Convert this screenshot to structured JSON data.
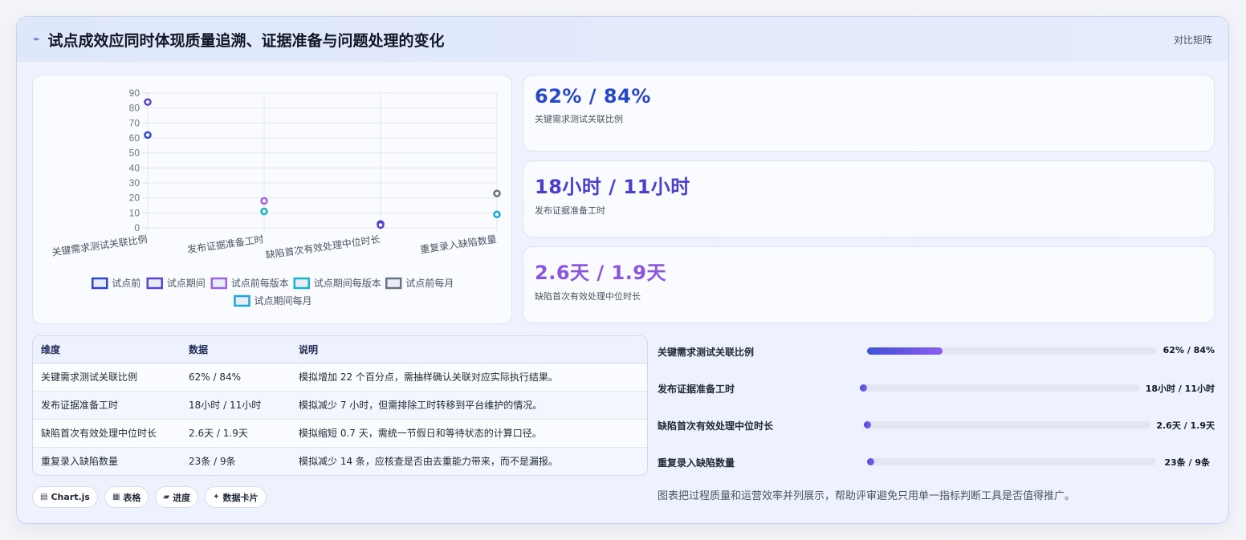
{
  "header": {
    "title": "试点成效应同时体现质量追溯、证据准备与问题处理的变化",
    "tag": "对比矩阵"
  },
  "chart_data": {
    "type": "scatter",
    "categories": [
      "关键需求测试关联比例",
      "发布证据准备工时",
      "缺陷首次有效处理中位时长",
      "重复录入缺陷数量"
    ],
    "yticks": [
      0,
      10,
      20,
      30,
      40,
      50,
      60,
      70,
      80,
      90
    ],
    "ylim": [
      0,
      90
    ],
    "grid": true,
    "legend_position": "bottom",
    "series": [
      {
        "name": "试点前",
        "color": "#2e45c7",
        "points": [
          {
            "category": 0,
            "y": 62
          },
          {
            "category": 2,
            "y": 2.6
          }
        ]
      },
      {
        "name": "试点期间",
        "color": "#5a43d0",
        "points": [
          {
            "category": 0,
            "y": 84
          },
          {
            "category": 2,
            "y": 1.9
          }
        ]
      },
      {
        "name": "试点前每版本",
        "color": "#9a63e0",
        "points": [
          {
            "category": 1,
            "y": 18
          }
        ]
      },
      {
        "name": "试点期间每版本",
        "color": "#19b3c9",
        "points": [
          {
            "category": 1,
            "y": 11
          }
        ]
      },
      {
        "name": "试点前每月",
        "color": "#6b7280",
        "points": [
          {
            "category": 3,
            "y": 23
          }
        ]
      },
      {
        "name": "试点期间每月",
        "color": "#1ea6d6",
        "points": [
          {
            "category": 3,
            "y": 9
          }
        ]
      }
    ]
  },
  "stats": [
    {
      "value": "62% / 84%",
      "label": "关键需求测试关联比例",
      "color": "#2a47c8"
    },
    {
      "value": "18小时 / 11小时",
      "label": "发布证据准备工时",
      "color": "#4b3fcf"
    },
    {
      "value": "2.6天 / 1.9天",
      "label": "缺陷首次有效处理中位时长",
      "color": "#8b55e0"
    }
  ],
  "table": {
    "headers": [
      "维度",
      "数据",
      "说明"
    ],
    "rows": [
      [
        "关键需求测试关联比例",
        "62% / 84%",
        "模拟增加 22 个百分点，需抽样确认关联对应实际执行结果。"
      ],
      [
        "发布证据准备工时",
        "18小时 / 11小时",
        "模拟减少 7 小时，但需排除工时转移到平台维护的情况。"
      ],
      [
        "缺陷首次有效处理中位时长",
        "2.6天 / 1.9天",
        "模拟缩短 0.7 天，需统一节假日和等待状态的计算口径。"
      ],
      [
        "重复录入缺陷数量",
        "23条 / 9条",
        "模拟减少 14 条，应核查是否由去重能力带来，而不是漏报。"
      ]
    ]
  },
  "chips": [
    {
      "icon": "▤",
      "label": "Chart.js"
    },
    {
      "icon": "▦",
      "label": "表格"
    },
    {
      "icon": "▰",
      "label": "进度"
    },
    {
      "icon": "✦",
      "label": "数据卡片"
    }
  ],
  "progress": [
    {
      "label": "关键需求测试关联比例",
      "value": "62% / 84%",
      "fraction": 0.26
    },
    {
      "label": "发布证据准备工时",
      "value": "18小时 / 11小时",
      "fraction": 0.02
    },
    {
      "label": "缺陷首次有效处理中位时长",
      "value": "2.6天 / 1.9天",
      "fraction": 0.02
    },
    {
      "label": "重复录入缺陷数量",
      "value": "23条 / 9条",
      "fraction": 0.02
    }
  ],
  "note": "图表把过程质量和运营效率并列展示，帮助评审避免只用单一指标判断工具是否值得推广。"
}
